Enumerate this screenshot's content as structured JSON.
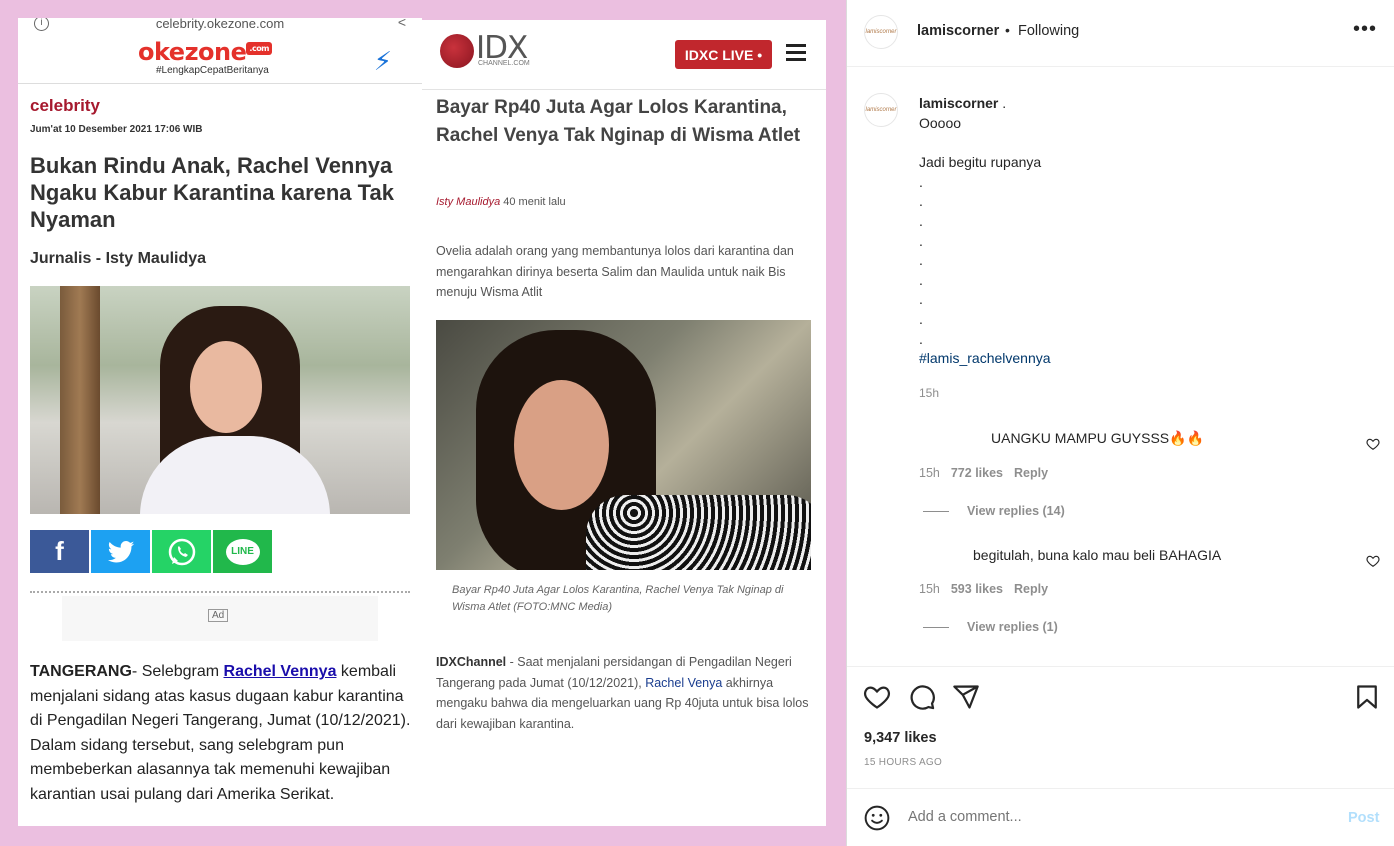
{
  "left_article": {
    "url": "celebrity.okezone.com",
    "logo": "okezone",
    "logo_com": ".com",
    "tagline": "#LengkapCepatBeritanya",
    "category": "celebrity",
    "date": "Jum'at 10 Desember 2021 17:06 WIB",
    "title": "Bukan Rindu Anak, Rachel Vennya Ngaku Kabur Karantina karena Tak Nyaman",
    "author": "Jurnalis - Isty Maulidya",
    "share_icons": [
      "facebook-icon",
      "twitter-icon",
      "whatsapp-icon",
      "line-icon"
    ],
    "share_line_label": "LINE",
    "ad_label": "Ad",
    "body_lead": "TANGERANG",
    "body_pre": "- Selebgram ",
    "body_link": "Rachel Vennya",
    "body_post": " kembali menjalani sidang atas kasus dugaan kabur karantina di Pengadilan Negeri Tangerang, Jumat (10/12/2021). Dalam sidang tersebut, sang selebgram pun membeberkan alasannya tak memenuhi kewajiban karantian usai pulang dari Amerika Serikat."
  },
  "right_article": {
    "logo": "IDX",
    "logo_sub": "CHANNEL.COM",
    "live_button": "IDXC LIVE •",
    "title": "Bayar Rp40 Juta Agar Lolos Karantina, Rachel Venya Tak Nginap di Wisma Atlet",
    "byline_author": "Isty Maulidya",
    "byline_time": " 40 menit lalu",
    "lead": "Ovelia adalah orang yang membantunya lolos dari karantina dan mengarahkan dirinya beserta Salim dan Maulida untuk naik Bis menuju Wisma Atlit",
    "caption": "Bayar Rp40 Juta Agar Lolos Karantina, Rachel Venya Tak Nginap di Wisma Atlet (FOTO:MNC Media)",
    "body_source": "IDXChannel",
    "body_pre": " - Saat menjalani persidangan di Pengadilan Negeri Tangerang pada Jumat (10/12/2021), ",
    "body_link": "Rachel Venya",
    "body_post": " akhirnya mengaku bahwa dia mengeluarkan uang Rp 40juta untuk bisa lolos dari kewajiban karantina."
  },
  "header": {
    "username": "lamiscorner",
    "separator": "•",
    "follow_status": "Following",
    "more": "•••"
  },
  "caption": {
    "username": "lamiscorner",
    "username_suffix": " .",
    "lines": [
      "Ooooo",
      "",
      "Jadi begitu rupanya",
      ".",
      ".",
      ".",
      ".",
      ".",
      ".",
      ".",
      ".",
      "."
    ],
    "hashtag": "#lamis_rachelvennya",
    "time": "15h"
  },
  "comments": [
    {
      "text": "UANGKU MAMPU GUYSSS🔥🔥",
      "time": "15h",
      "likes": "772 likes",
      "reply": "Reply",
      "view_replies": "View replies (14)"
    },
    {
      "text": "begitulah, buna kalo mau beli BAHAGIA",
      "time": "15h",
      "likes": "593 likes",
      "reply": "Reply",
      "view_replies": "View replies (1)"
    }
  ],
  "actions": {
    "icons": [
      "heart-icon",
      "comment-icon",
      "share-icon",
      "bookmark-icon"
    ],
    "likes": "9,347 likes",
    "ago": "15 HOURS AGO"
  },
  "add_comment": {
    "placeholder": "Add a comment...",
    "post_label": "Post"
  },
  "colors": {
    "background_pink": "#ebbfe0",
    "okezone_red": "#e4312b",
    "idx_red": "#c1272d",
    "hashtag": "#00376b",
    "post_disabled": "#b2dffc",
    "muted": "#8e8e8e"
  }
}
